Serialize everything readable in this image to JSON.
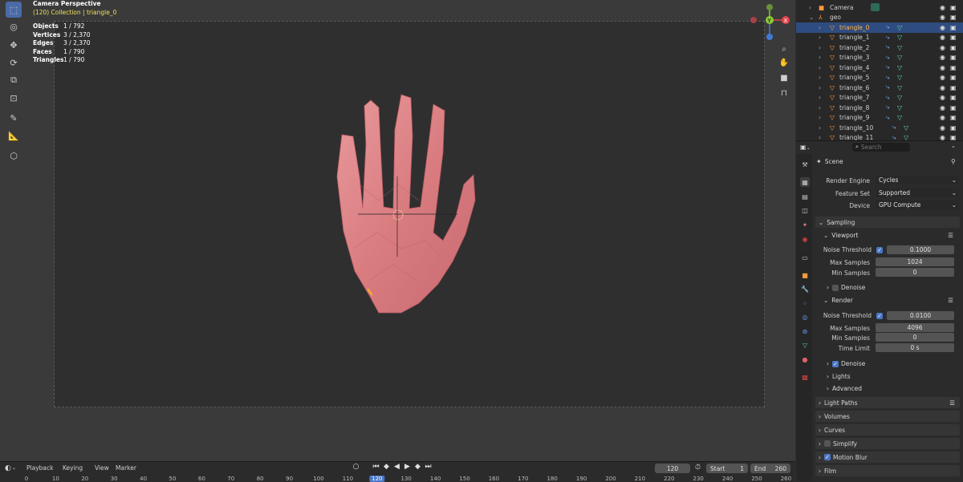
{
  "viewport": {
    "title": "Camera Perspective",
    "subtitle": "(120) Collection | triangle_0",
    "stats": [
      {
        "label": "Objects",
        "value": "1 / 792"
      },
      {
        "label": "Vertices",
        "value": "3 / 2,370"
      },
      {
        "label": "Edges",
        "value": "3 / 2,370"
      },
      {
        "label": "Faces",
        "value": "1 / 790"
      },
      {
        "label": "Triangles",
        "value": "1 / 790"
      }
    ],
    "gizmo": {
      "y_label": "Y",
      "x_label": "X",
      "y_color": "#8bc83a",
      "x_color": "#e3434b",
      "z_color": "#3f7bd6"
    }
  },
  "timeline": {
    "menus": [
      "Playback",
      "Keying",
      "View",
      "Marker"
    ],
    "current_frame": "120",
    "start_label": "Start",
    "start_value": "1",
    "end_label": "End",
    "end_value": "260",
    "ruler": [
      "0",
      "10",
      "20",
      "30",
      "40",
      "50",
      "60",
      "70",
      "80",
      "90",
      "100",
      "110",
      "120",
      "130",
      "140",
      "150",
      "160",
      "170",
      "180",
      "190",
      "200",
      "210",
      "220",
      "230",
      "240",
      "250",
      "260"
    ]
  },
  "outliner": {
    "rows": [
      {
        "label": "Camera",
        "type": "camera"
      },
      {
        "label": "geo",
        "type": "collection"
      },
      {
        "label": "triangle_0",
        "type": "mesh",
        "selected": true
      },
      {
        "label": "triangle_1",
        "type": "mesh"
      },
      {
        "label": "triangle_2",
        "type": "mesh"
      },
      {
        "label": "triangle_3",
        "type": "mesh"
      },
      {
        "label": "triangle_4",
        "type": "mesh"
      },
      {
        "label": "triangle_5",
        "type": "mesh"
      },
      {
        "label": "triangle_6",
        "type": "mesh"
      },
      {
        "label": "triangle_7",
        "type": "mesh"
      },
      {
        "label": "triangle_8",
        "type": "mesh"
      },
      {
        "label": "triangle_9",
        "type": "mesh"
      },
      {
        "label": "triangle_10",
        "type": "mesh"
      },
      {
        "label": "triangle_11",
        "type": "mesh"
      }
    ]
  },
  "properties": {
    "search_placeholder": "Search",
    "context": "Scene",
    "render_engine_label": "Render Engine",
    "render_engine": "Cycles",
    "feature_set_label": "Feature Set",
    "feature_set": "Supported",
    "device_label": "Device",
    "device": "GPU Compute",
    "sampling": "Sampling",
    "viewport": "Viewport",
    "noise_threshold_label": "Noise Threshold",
    "viewport_noise_threshold": "0.1000",
    "max_samples_label": "Max Samples",
    "viewport_max_samples": "1024",
    "min_samples_label": "Min Samples",
    "viewport_min_samples": "0",
    "denoise_label": "Denoise",
    "render": "Render",
    "render_noise_threshold": "0.0100",
    "render_max_samples": "4096",
    "render_min_samples": "0",
    "time_limit_label": "Time Limit",
    "render_time_limit": "0 s",
    "lights": "Lights",
    "advanced": "Advanced",
    "panels": [
      "Light Paths",
      "Volumes",
      "Curves",
      "Simplify",
      "Motion Blur",
      "Film"
    ]
  },
  "colors": {
    "accent": "#4a77c9",
    "selected_row": "#2f4c80",
    "active_label": "#ffb54a"
  }
}
